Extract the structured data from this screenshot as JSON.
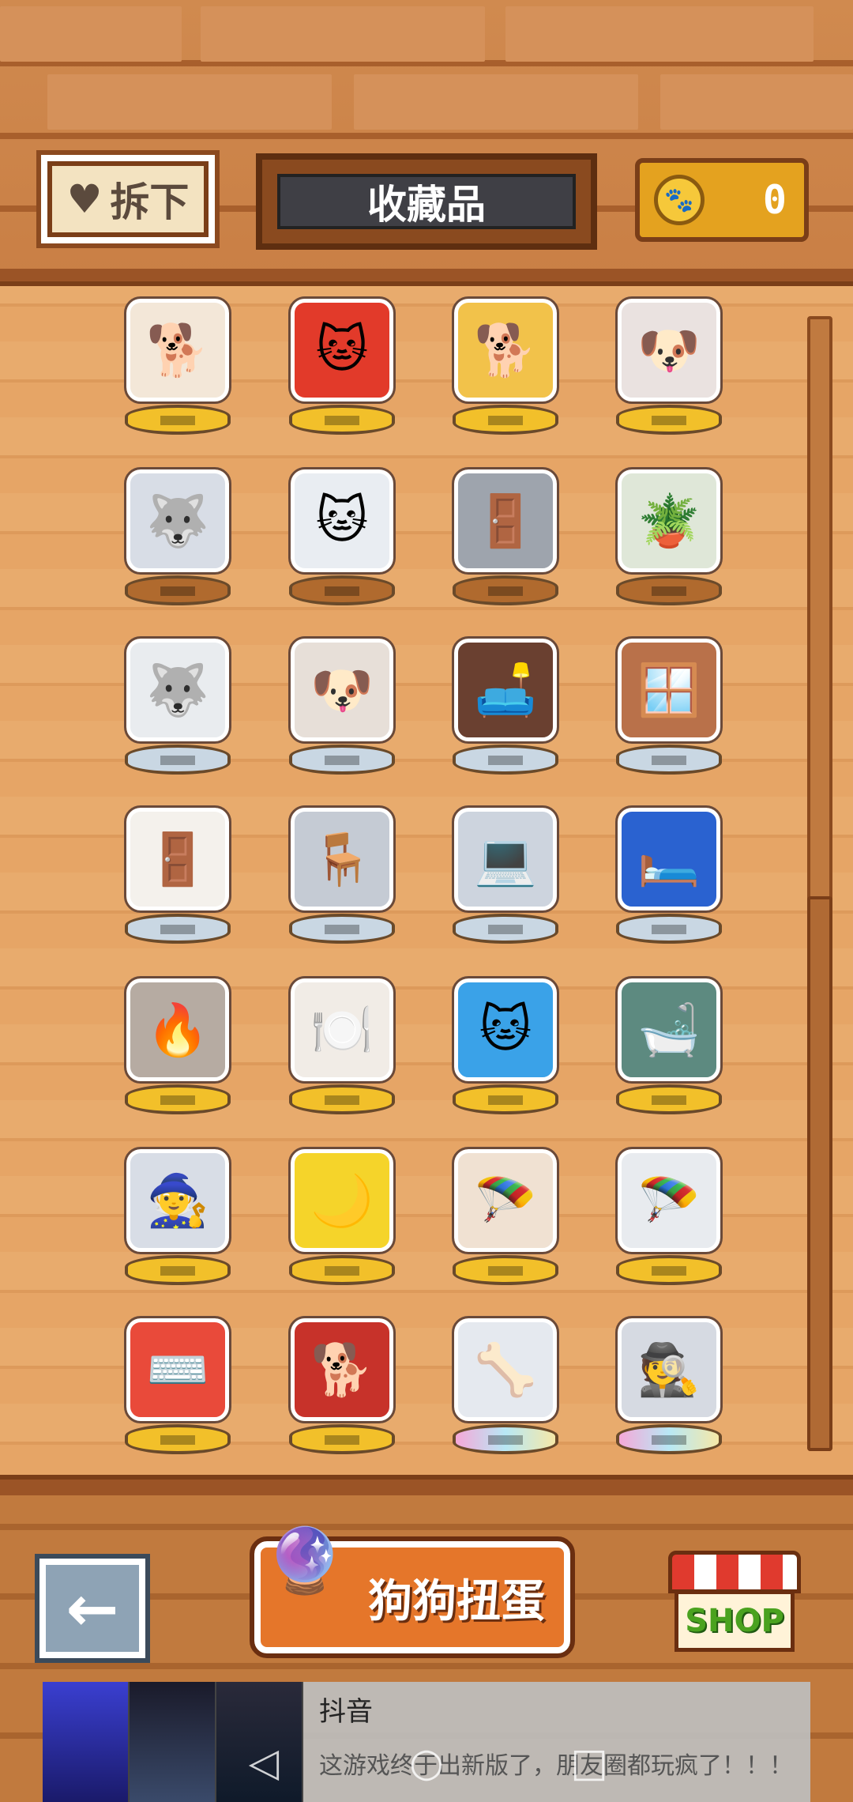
{
  "header": {
    "remove_label": "拆下",
    "title": "收藏品",
    "coin_count": "0"
  },
  "collection": {
    "items": [
      {
        "name": "dog-desk-figurine",
        "emoji": "🐕",
        "base": "gold",
        "fig_bg": "#f3e7d8"
      },
      {
        "name": "cat-snow-globe-red",
        "emoji": "🐱",
        "base": "gold",
        "fig_bg": "#e23a2a"
      },
      {
        "name": "dog-nest-figurine",
        "emoji": "🐕",
        "base": "gold",
        "fig_bg": "#f2c24a"
      },
      {
        "name": "dogs-pile-figurine",
        "emoji": "🐶",
        "base": "gold",
        "fig_bg": "#eae2e0"
      },
      {
        "name": "husky-figurine",
        "emoji": "🐺",
        "base": "bronze",
        "fig_bg": "#d8dde6"
      },
      {
        "name": "cat-pole-figurine",
        "emoji": "🐱",
        "base": "bronze",
        "fig_bg": "#e9edf2"
      },
      {
        "name": "wardrobe-figurine",
        "emoji": "🚪",
        "base": "bronze",
        "fig_bg": "#9ea4ad"
      },
      {
        "name": "plant-table-figurine",
        "emoji": "🪴",
        "base": "bronze",
        "fig_bg": "#dfe7d8"
      },
      {
        "name": "window-husky-figurine",
        "emoji": "🐺",
        "base": "silver",
        "fig_bg": "#e9ecef"
      },
      {
        "name": "corgi-husky-pair-figurine",
        "emoji": "🐶",
        "base": "silver",
        "fig_bg": "#e7dfd8"
      },
      {
        "name": "couch-figurine",
        "emoji": "🛋️",
        "base": "silver",
        "fig_bg": "#6a4030"
      },
      {
        "name": "round-window-figurine",
        "emoji": "🪟",
        "base": "silver",
        "fig_bg": "#b9714a"
      },
      {
        "name": "arch-door-figurine",
        "emoji": "🚪",
        "base": "silver",
        "fig_bg": "#f4f1ec"
      },
      {
        "name": "armchair-figurine",
        "emoji": "🪑",
        "base": "silver",
        "fig_bg": "#c5cbd4"
      },
      {
        "name": "computer-desk-figurine",
        "emoji": "💻",
        "base": "silver",
        "fig_bg": "#cdd4de"
      },
      {
        "name": "blue-bed-figurine",
        "emoji": "🛏️",
        "base": "silver",
        "fig_bg": "#2a62d0"
      },
      {
        "name": "fireplace-figurine",
        "emoji": "🔥",
        "base": "gold",
        "fig_bg": "#b6aba2"
      },
      {
        "name": "dinner-table-figurine",
        "emoji": "🍽️",
        "base": "gold",
        "fig_bg": "#f1ece6"
      },
      {
        "name": "cat-snow-globe-blue",
        "emoji": "🐱",
        "base": "gold",
        "fig_bg": "#3aa2e8"
      },
      {
        "name": "bathtub-figurine",
        "emoji": "🛁",
        "base": "gold",
        "fig_bg": "#5d8a80"
      },
      {
        "name": "witch-husky-figurine",
        "emoji": "🧙",
        "base": "gold",
        "fig_bg": "#d8dde6"
      },
      {
        "name": "moon-husky-figurine",
        "emoji": "🌙",
        "base": "gold",
        "fig_bg": "#f5d42a"
      },
      {
        "name": "parachute-shiba-figurine",
        "emoji": "🪂",
        "base": "gold",
        "fig_bg": "#f0e1d2"
      },
      {
        "name": "parachute-husky-figurine",
        "emoji": "🪂",
        "base": "gold",
        "fig_bg": "#e8ebef"
      },
      {
        "name": "keyboard-husky-figurine",
        "emoji": "⌨️",
        "base": "gold",
        "fig_bg": "#e94a3a"
      },
      {
        "name": "chair-shiba-figurine",
        "emoji": "🐕",
        "base": "gold",
        "fig_bg": "#c7322a"
      },
      {
        "name": "husky-bone-figurine",
        "emoji": "🦴",
        "base": "rainbow",
        "fig_bg": "#e5e9ef"
      },
      {
        "name": "detective-husky-figurine",
        "emoji": "🕵️",
        "base": "rainbow",
        "fig_bg": "#d6dae2"
      }
    ]
  },
  "footer": {
    "back_icon": "←",
    "gacha_label": "狗狗扭蛋",
    "gacha_icon": "gacha-balls",
    "shop_label": "SHOP"
  },
  "ad": {
    "title": "抖音",
    "description": "这游戏终于出新版了，朋友圈都玩疯了！！！"
  },
  "colors": {
    "gold_base": "#f2c02a",
    "bronze_base": "#b06a2e",
    "silver_base": "#c9d7e3",
    "rainbow_base": "#f0c8e6"
  }
}
